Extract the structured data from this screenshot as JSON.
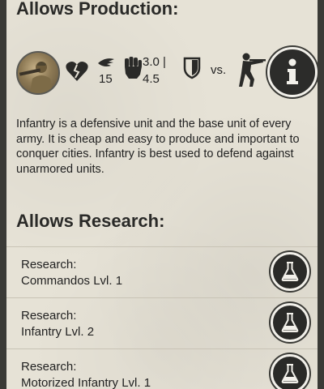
{
  "production": {
    "heading": "Allows Production:",
    "unit": {
      "portrait_icon": "infantry-soldier-portrait",
      "health_icon": "broken-heart-icon",
      "speed_icon": "wing-speed-icon",
      "speed_value": "15",
      "attack_icon": "fist-attack-icon",
      "attack_value_line1": "3.0 |",
      "attack_value_line2": "4.5",
      "armor_icon": "shield-icon",
      "vs_label": "vs.",
      "target_icon": "rifleman-icon",
      "info_icon": "info-icon"
    },
    "description": "Infantry is a defensive unit and the base unit of every army. It is cheap and easy to produce and important to conquer cities. Infantry is best used to defend against unarmored units."
  },
  "research": {
    "heading": "Allows Research:",
    "items": [
      {
        "line1": "Research:",
        "line2": "Commandos Lvl. 1",
        "icon": "flask-icon"
      },
      {
        "line1": "Research:",
        "line2": "Infantry Lvl. 2",
        "icon": "flask-icon"
      },
      {
        "line1": "Research:",
        "line2": "Motorized Infantry Lvl. 1",
        "icon": "flask-icon"
      }
    ]
  },
  "colors": {
    "panel_bg": "#e6e2d6",
    "button_dark": "#2a2a28",
    "button_ring": "#f2f0ea"
  }
}
